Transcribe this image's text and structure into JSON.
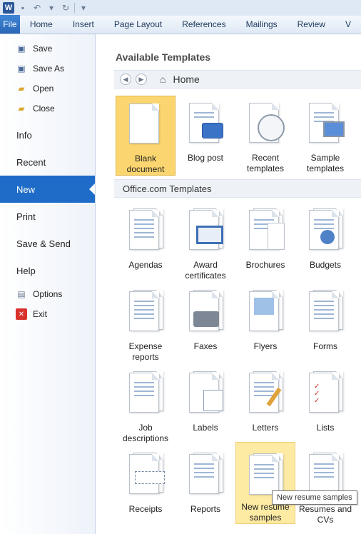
{
  "ribbon": {
    "tabs": [
      "File",
      "Home",
      "Insert",
      "Page Layout",
      "References",
      "Mailings",
      "Review",
      "V"
    ]
  },
  "nav": {
    "items": [
      {
        "label": "Save",
        "icon": "save-icon",
        "kind": "small"
      },
      {
        "label": "Save As",
        "icon": "save-as-icon",
        "kind": "small"
      },
      {
        "label": "Open",
        "icon": "open-folder-icon",
        "kind": "small"
      },
      {
        "label": "Close",
        "icon": "close-folder-icon",
        "kind": "small"
      },
      {
        "label": "Info",
        "kind": "big"
      },
      {
        "label": "Recent",
        "kind": "big"
      },
      {
        "label": "New",
        "kind": "big",
        "active": true
      },
      {
        "label": "Print",
        "kind": "big"
      },
      {
        "label": "Save & Send",
        "kind": "big"
      },
      {
        "label": "Help",
        "kind": "big"
      },
      {
        "label": "Options",
        "icon": "options-icon",
        "kind": "small"
      },
      {
        "label": "Exit",
        "icon": "exit-icon",
        "kind": "small"
      }
    ]
  },
  "main": {
    "title": "Available Templates",
    "breadcrumb": "Home",
    "section_title": "Office.com Templates",
    "local_templates": [
      {
        "label": "Blank document",
        "icon": "blank-document-icon",
        "selected": true
      },
      {
        "label": "Blog post",
        "icon": "blog-post-icon"
      },
      {
        "label": "Recent templates",
        "icon": "recent-templates-icon"
      },
      {
        "label": "Sample templates",
        "icon": "sample-templates-icon"
      }
    ],
    "office_templates": [
      {
        "label": "Agendas",
        "icon": "agendas-icon"
      },
      {
        "label": "Award certificates",
        "icon": "award-certificates-icon"
      },
      {
        "label": "Brochures",
        "icon": "brochures-icon"
      },
      {
        "label": "Budgets",
        "icon": "budgets-icon"
      },
      {
        "label": "Expense reports",
        "icon": "expense-reports-icon"
      },
      {
        "label": "Faxes",
        "icon": "faxes-icon"
      },
      {
        "label": "Flyers",
        "icon": "flyers-icon"
      },
      {
        "label": "Forms",
        "icon": "forms-icon"
      },
      {
        "label": "Job descriptions",
        "icon": "job-descriptions-icon"
      },
      {
        "label": "Labels",
        "icon": "labels-icon"
      },
      {
        "label": "Letters",
        "icon": "letters-icon"
      },
      {
        "label": "Lists",
        "icon": "lists-icon"
      },
      {
        "label": "Receipts",
        "icon": "receipts-icon"
      },
      {
        "label": "Reports",
        "icon": "reports-icon"
      },
      {
        "label": "New resume samples",
        "icon": "new-resume-samples-icon",
        "hover": true
      },
      {
        "label": "Resumes and CVs",
        "icon": "resumes-and-cvs-icon"
      }
    ],
    "tooltip": "New resume samples"
  },
  "colors": {
    "file_tab": "#2a66b6",
    "nav_active": "#1e6cc8",
    "selected_tile": "#fbd670",
    "hover_tile": "#fdeaa3"
  }
}
